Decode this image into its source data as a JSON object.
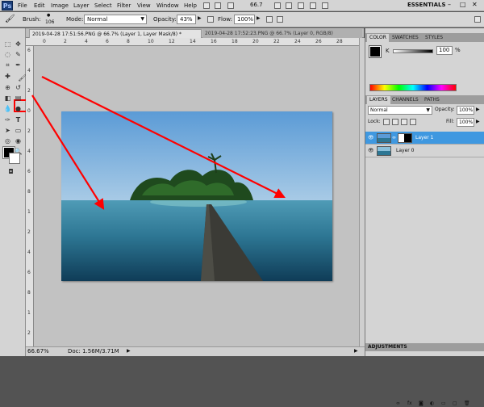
{
  "menubar": {
    "logo": "Ps",
    "items": [
      "File",
      "Edit",
      "Image",
      "Layer",
      "Select",
      "Filter",
      "View",
      "Window",
      "Help"
    ],
    "zoom": "66.7",
    "workspace": "ESSENTIALS"
  },
  "options": {
    "brush_label": "Brush:",
    "brush_size": "106",
    "mode_label": "Mode:",
    "mode_value": "Normal",
    "opacity_label": "Opacity:",
    "opacity_value": "43%",
    "flow_label": "Flow:",
    "flow_value": "100%"
  },
  "tabs": [
    {
      "label": "2019-04-28 17:51:56.PNG @ 66.7% (Layer 1, Layer Mask/8) *"
    },
    {
      "label": "2019-04-28 17:52:23.PNG @ 66.7% (Layer 0, RGB/8)"
    }
  ],
  "rulers": {
    "top": [
      "0",
      "2",
      "4",
      "6",
      "8",
      "10",
      "12",
      "14",
      "16",
      "18",
      "20",
      "22",
      "24",
      "26",
      "28"
    ],
    "left": [
      "6",
      "4",
      "2",
      "0",
      "2",
      "4",
      "6",
      "8",
      "1",
      "2",
      "4",
      "6",
      "8",
      "1",
      "2"
    ]
  },
  "status": {
    "zoom": "66.67%",
    "doc": "Doc: 1.56M/3.71M"
  },
  "color_panel": {
    "tabs": [
      "COLOR",
      "SWATCHES",
      "STYLES"
    ],
    "channel": "K",
    "value": "100",
    "unit": "%"
  },
  "layers_panel": {
    "tabs": [
      "LAYERS",
      "CHANNELS",
      "PATHS"
    ],
    "blend_mode": "Normal",
    "opacity_label": "Opacity:",
    "opacity_value": "100%",
    "lock_label": "Lock:",
    "fill_label": "Fill:",
    "fill_value": "100%",
    "layers": [
      {
        "name": "Layer 1",
        "selected": true
      },
      {
        "name": "Layer 0",
        "selected": false
      }
    ]
  },
  "adjustments": "ADJUSTMENTS",
  "colors": {
    "annotation": "#ff0000",
    "selected_layer": "#3f98e0"
  }
}
